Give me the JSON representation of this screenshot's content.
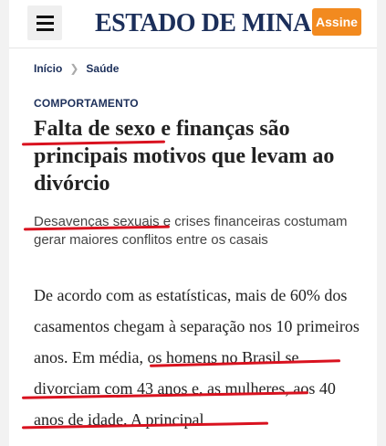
{
  "header": {
    "menu_icon": "hamburger-menu-icon",
    "logo_text": "ESTADO DE MINAS",
    "subscribe_label": "Assine",
    "accent_color": "#f28a1f",
    "brand_color": "#1c2f5a"
  },
  "breadcrumb": {
    "home": "Início",
    "separator_icon": "chevron-right-icon",
    "current": "Saúde"
  },
  "article": {
    "section": "COMPORTAMENTO",
    "headline": {
      "part1": "Falta de sexo",
      "part2": " e finanças são principais motivos que levam ao divórcio"
    },
    "subtitle": {
      "part1": "Desavenças sexuais",
      "part2": " e crises financeiras costumam gerar maiores conflitos entre os casais"
    },
    "body": {
      "part1": "De acordo com as estatísticas, mais de 60% dos casamentos chegam à separação nos 10 primeiros anos. ",
      "part2": "Em média, os homens no Brasil se divorciam com 43 anos e, as mulheres, aos 40 anos de idade.",
      "part3": " A principal"
    },
    "highlight_color": "#d9121f"
  }
}
